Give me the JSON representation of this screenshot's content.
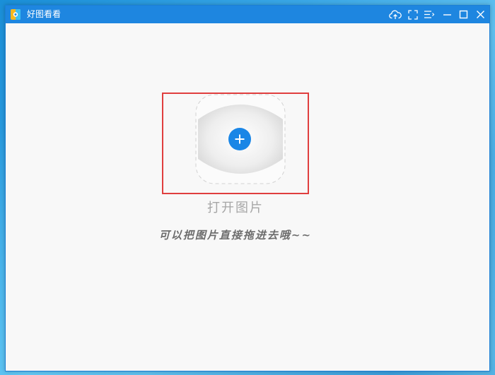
{
  "window": {
    "title": "好图看看"
  },
  "titlebar": {
    "buttons": [
      {
        "icon": "upload-cloud-icon"
      },
      {
        "icon": "fullscreen-icon"
      },
      {
        "icon": "menu-icon"
      },
      {
        "icon": "minimize-icon"
      },
      {
        "icon": "maximize-icon"
      },
      {
        "icon": "close-icon"
      }
    ]
  },
  "main": {
    "open_label": "打开图片",
    "hint": "可以把图片直接拖进去哦~~"
  },
  "colors": {
    "titlebar": "#1e86e0",
    "accent": "#1a86e6",
    "highlight_border": "#e03e3e",
    "label": "#a6a6a6",
    "hint": "#6c6c6c"
  }
}
